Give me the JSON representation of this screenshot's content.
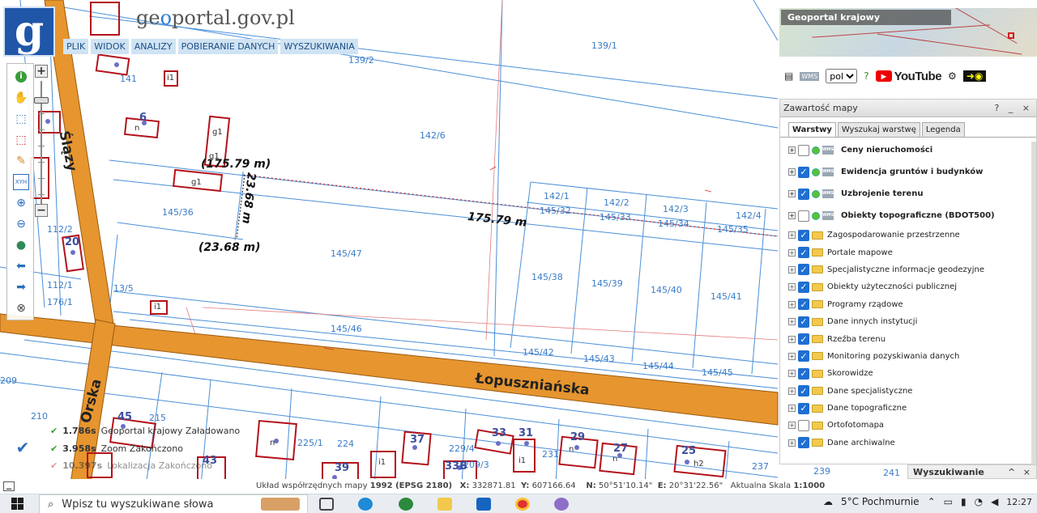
{
  "header": {
    "brand_prefix": "ge",
    "brand_accent": "o",
    "brand_mid": "portal",
    "brand_suffix": ".gov.pl",
    "logo_letter": "g"
  },
  "menu": [
    "PLIK",
    "WIDOK",
    "ANALIZY",
    "POBIERANIE DANYCH",
    "WYSZUKIWANIA"
  ],
  "overview": {
    "title": "Geoportal krajowy"
  },
  "iconbar": {
    "language": "pol",
    "youtube": "YouTube"
  },
  "panel": {
    "title": "Zawartość mapy",
    "controls": "? _ ×",
    "tabs": [
      "Warstwy",
      "Wyszukaj warstwę",
      "Legenda"
    ],
    "layers": [
      {
        "name": "Ceny nieruchomości",
        "checked": false,
        "kind": "wms"
      },
      {
        "name": "Ewidencja gruntów i budynków",
        "checked": true,
        "kind": "wms"
      },
      {
        "name": "Uzbrojenie terenu",
        "checked": true,
        "kind": "wms"
      },
      {
        "name": "Obiekty topograficzne (BDOT500)",
        "checked": false,
        "kind": "wms"
      },
      {
        "name": "Zagospodarowanie przestrzenne",
        "checked": true,
        "kind": "folder"
      },
      {
        "name": "Portale mapowe",
        "checked": true,
        "kind": "folder"
      },
      {
        "name": "Specjalistyczne informacje geodezyjne",
        "checked": true,
        "kind": "folder"
      },
      {
        "name": "Obiekty użyteczności publicznej",
        "checked": true,
        "kind": "folder"
      },
      {
        "name": "Programy rządowe",
        "checked": true,
        "kind": "folder"
      },
      {
        "name": "Dane innych instytucji",
        "checked": true,
        "kind": "folder"
      },
      {
        "name": "Rzeźba terenu",
        "checked": true,
        "kind": "folder"
      },
      {
        "name": "Monitoring pozyskiwania danych",
        "checked": true,
        "kind": "folder"
      },
      {
        "name": "Skorowidze",
        "checked": true,
        "kind": "folder"
      },
      {
        "name": "Dane specjalistyczne",
        "checked": true,
        "kind": "folder"
      },
      {
        "name": "Dane topograficzne",
        "checked": true,
        "kind": "folder"
      },
      {
        "name": "Ortofotomapa",
        "checked": false,
        "kind": "folder"
      },
      {
        "name": "Dane archiwalne",
        "checked": true,
        "kind": "folder"
      }
    ],
    "search_title": "Wyszukiwanie",
    "search_controls": "^ ×"
  },
  "status": {
    "rows": [
      {
        "time": "1.786s",
        "label": "Geoportal krajowy",
        "state": "Załadowano"
      },
      {
        "time": "3.958s",
        "label": "Zoom",
        "state": "Zakończono"
      },
      {
        "time": "10.397s",
        "label": "Lokalizacja",
        "state": "Zakończono"
      }
    ]
  },
  "coords": {
    "system_label": "Układ współrzędnych mapy",
    "system_value": "1992 (EPSG 2180)",
    "x_label": "X:",
    "x_value": "332871.81",
    "y_label": "Y:",
    "y_value": "607166.64",
    "n_label": "N:",
    "n_value": "50°51'10.14\"",
    "e_label": "E:",
    "e_value": "20°31'22.56\"",
    "scale_label": "Aktualna Skala",
    "scale_value": "1:1000"
  },
  "map": {
    "parcels": [
      "139/2",
      "139/1",
      "141",
      "142/6",
      "145/36",
      "145/47",
      "112/2",
      "112/1",
      "176/1",
      "13/5",
      "142/1",
      "145/32",
      "142/2",
      "145/33",
      "142/3",
      "145/34",
      "142/4",
      "145/35",
      "145/38",
      "145/39",
      "145/40",
      "145/41",
      "145/46",
      "145/42",
      "145/43",
      "145/44",
      "145/45",
      "210",
      "215",
      "224",
      "229/4",
      "231",
      "237",
      "239",
      "241",
      "225/1",
      "209",
      "209/3"
    ],
    "measure_top": "(175.79 m)",
    "measure_line": "175.79 m",
    "measure_vert": "23.68 m",
    "measure_bottom": "(23.68 m)",
    "streets": [
      "Ślązy",
      "Łopuszniańska",
      "Orska"
    ],
    "building_numbers": [
      "6",
      "20",
      "45",
      "37",
      "39",
      "33",
      "31",
      "29",
      "27",
      "25",
      "33B",
      "43"
    ],
    "building_types": [
      "g1",
      "g1",
      "g1",
      "i1",
      "i1",
      "i1",
      "i1",
      "n",
      "n",
      "n",
      "n",
      "h2"
    ]
  },
  "taskbar": {
    "search_placeholder": "Wpisz tu wyszukiwane słowa",
    "weather": "5°C Pochmurnie",
    "time": "12:27"
  }
}
